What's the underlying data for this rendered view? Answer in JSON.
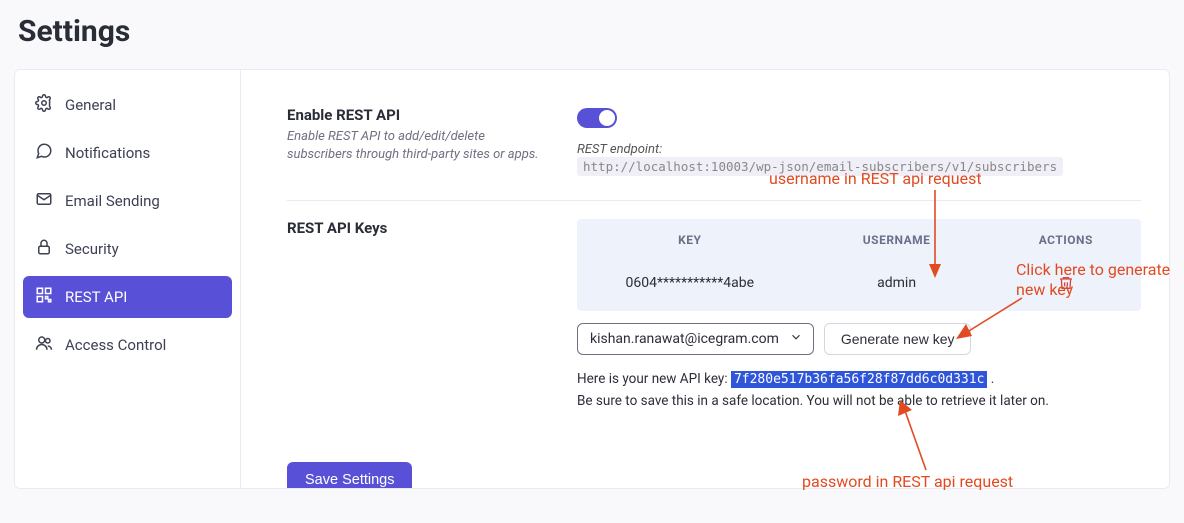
{
  "page": {
    "title": "Settings"
  },
  "sidebar": {
    "items": [
      {
        "label": "General",
        "icon": "gear"
      },
      {
        "label": "Notifications",
        "icon": "chat"
      },
      {
        "label": "Email Sending",
        "icon": "mail"
      },
      {
        "label": "Security",
        "icon": "lock"
      },
      {
        "label": "REST API",
        "icon": "qr"
      },
      {
        "label": "Access Control",
        "icon": "users"
      }
    ]
  },
  "enable_section": {
    "title": "Enable REST API",
    "desc": "Enable REST API to add/edit/delete subscribers through third-party sites or apps.",
    "endpoint_label": "REST endpoint:",
    "endpoint_url": "http://localhost:10003/wp-json/email-subscribers/v1/subscribers"
  },
  "keys_section": {
    "title": "REST API Keys",
    "headers": {
      "key": "KEY",
      "username": "USERNAME",
      "actions": "ACTIONS"
    },
    "rows": [
      {
        "key": "0604***********4abe",
        "username": "admin"
      }
    ],
    "user_select_value": "kishan.ranawat@icegram.com",
    "generate_btn": "Generate new key",
    "new_key_prefix": "Here is your new API key:",
    "new_key_value": "7f280e517b36fa56f28f87dd6c0d331c",
    "new_key_suffix": ".",
    "note_line2": "Be sure to save this in a safe location. You will not be able to retrieve it later on."
  },
  "save_button": "Save Settings",
  "annotations": {
    "a1": "username in REST api request",
    "a2": "Click here to generate new key",
    "a3": "password in REST api request"
  }
}
